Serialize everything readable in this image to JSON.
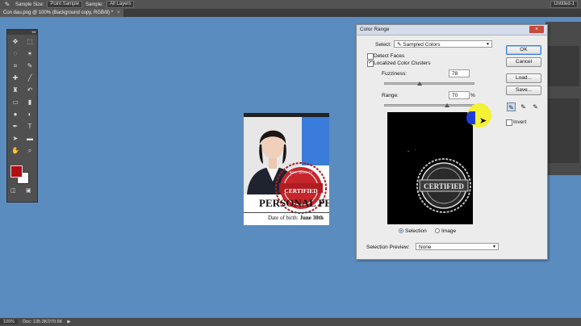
{
  "optbar": {
    "tool_icon": "eyedropper-icon",
    "sample_size_label": "Sample Size:",
    "sample_size_value": "Point Sample",
    "sample_label": "Sample:",
    "sample_value": "All Layers",
    "workspace_value": "Untitled-1"
  },
  "tab": {
    "title": "Con dau.png @ 100% (Background copy, RGB/8) *",
    "close": "×"
  },
  "status": {
    "zoom": "100%",
    "doc_info": "Doc: 135.3K/270.6K",
    "arrow": "▶"
  },
  "document": {
    "heading": "PERSONAL PET",
    "dob_label": "Date of birth:",
    "dob_value": "June 30th",
    "stamp_text": "CERTIFIED",
    "stamp_arc": "BEST QUALITY",
    "colors": {
      "blue_bar": "#3a7cd9",
      "stamp_red": "#b01c22"
    }
  },
  "dialog": {
    "title": "Color Range",
    "close": "×",
    "select_label": "Select:",
    "select_value": "Sampled Colors",
    "detect_faces_label": "Detect Faces",
    "detect_faces_checked": false,
    "localized_label": "Localized Color Clusters",
    "localized_checked": true,
    "fuzziness_label": "Fuzziness:",
    "fuzziness_value": "78",
    "fuzziness": 78,
    "fuzziness_max": 200,
    "range_label": "Range:",
    "range_value": "70",
    "range_unit": "%",
    "range_percent": 70,
    "ok": "OK",
    "cancel": "Cancel",
    "load": "Load...",
    "save": "Save...",
    "invert_label": "Invert",
    "invert_checked": false,
    "selection_radio": "Selection",
    "image_radio": "Image",
    "preview_label": "Selection Preview:",
    "preview_value": "None",
    "preview_stamp_text": "CERTIFIED"
  }
}
